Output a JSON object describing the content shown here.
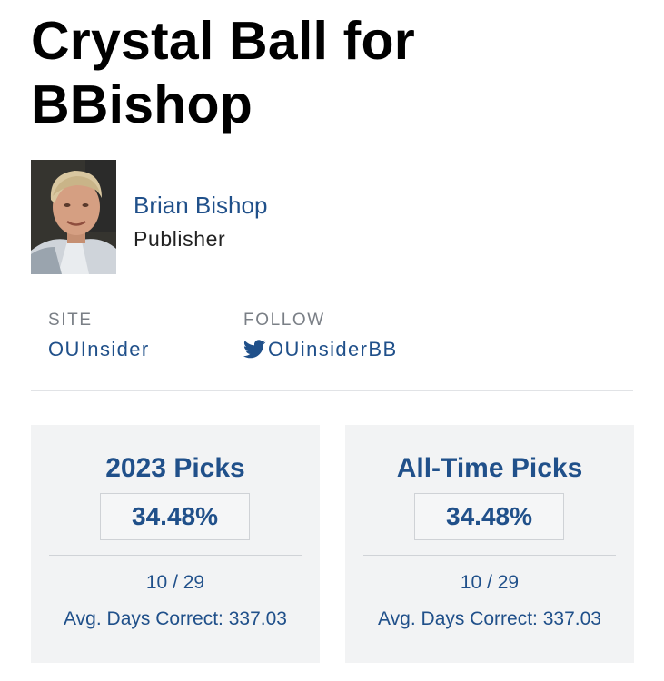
{
  "page": {
    "title": "Crystal Ball for BBishop"
  },
  "author": {
    "name": "Brian Bishop",
    "role": "Publisher"
  },
  "meta": {
    "site_label": "SITE",
    "site_value": "OUInsider",
    "follow_label": "FOLLOW",
    "follow_value": "OUinsiderBB",
    "follow_icon": "twitter-icon"
  },
  "cards": [
    {
      "title": "2023 Picks",
      "percentage": "34.48%",
      "record": "10 / 29",
      "avg_days": "Avg. Days Correct: 337.03"
    },
    {
      "title": "All-Time Picks",
      "percentage": "34.48%",
      "record": "10 / 29",
      "avg_days": "Avg. Days Correct: 337.03"
    }
  ],
  "colors": {
    "link_blue": "#20508a",
    "card_bg": "#f2f3f4",
    "label_gray": "#7a7f86"
  }
}
